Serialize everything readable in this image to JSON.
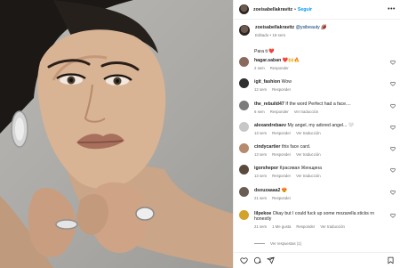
{
  "post": {
    "username": "zoeisabellakravitz",
    "follow_label": "Seguir",
    "more_label": "•••",
    "separator": "•",
    "caption": {
      "username": "zoeisabellakravitz",
      "mention": "@ysibeauty",
      "emoji": "🏈",
      "edited": "Editado",
      "time": "19 sem"
    },
    "caption_extra": "Para ti ❤️"
  },
  "comments": [
    {
      "username": "hagar.saban",
      "text": "❤️🙌🔥",
      "time": "2 sem",
      "actions": [
        "Responder"
      ],
      "avatar_color": "#8a6a5c"
    },
    {
      "username": "igit_fashion",
      "text": "Wow",
      "time": "12 sem",
      "actions": [
        "Responder"
      ],
      "avatar_color": "#2f2f2f"
    },
    {
      "username": "the_rebuild47",
      "text": "If the word Perfect had a face....",
      "time": "6 sem",
      "actions": [
        "Responder",
        "Ver traducción"
      ],
      "avatar_color": "#7b7b7b"
    },
    {
      "username": "alexandrebaev",
      "text": "My angel, my adored angel... 🤍",
      "time": "13 sem",
      "actions": [
        "Responder",
        "Ver traducción"
      ],
      "avatar_color": "#c7c7c7"
    },
    {
      "username": "cindycartier",
      "text": "this face card.",
      "time": "13 sem",
      "actions": [
        "Responder",
        "Ver traducción"
      ],
      "avatar_color": "#b58a6d"
    },
    {
      "username": "igorshepor",
      "text": "Красивая Женщина",
      "time": "13 sem",
      "actions": [
        "Responder",
        "Ver traducción"
      ],
      "avatar_color": "#5a4a3c"
    },
    {
      "username": "dsouzaaaa2",
      "text": "😍",
      "time": "21 sem",
      "actions": [
        "Responder"
      ],
      "avatar_color": "#6b5c52"
    },
    {
      "username": "lilpekoe",
      "text": "Okay but I could fuck up some mozarella sticks rn honestly",
      "time": "21 sem",
      "actions": [
        "1 Me gusta",
        "Responder",
        "Ver traducción"
      ],
      "avatar_color": "#d2a22a"
    }
  ],
  "view_replies": "Ver respuestas (1)",
  "actions": {
    "like": "heart-icon",
    "comment": "comment-icon",
    "share": "share-icon",
    "save": "bookmark-icon"
  }
}
